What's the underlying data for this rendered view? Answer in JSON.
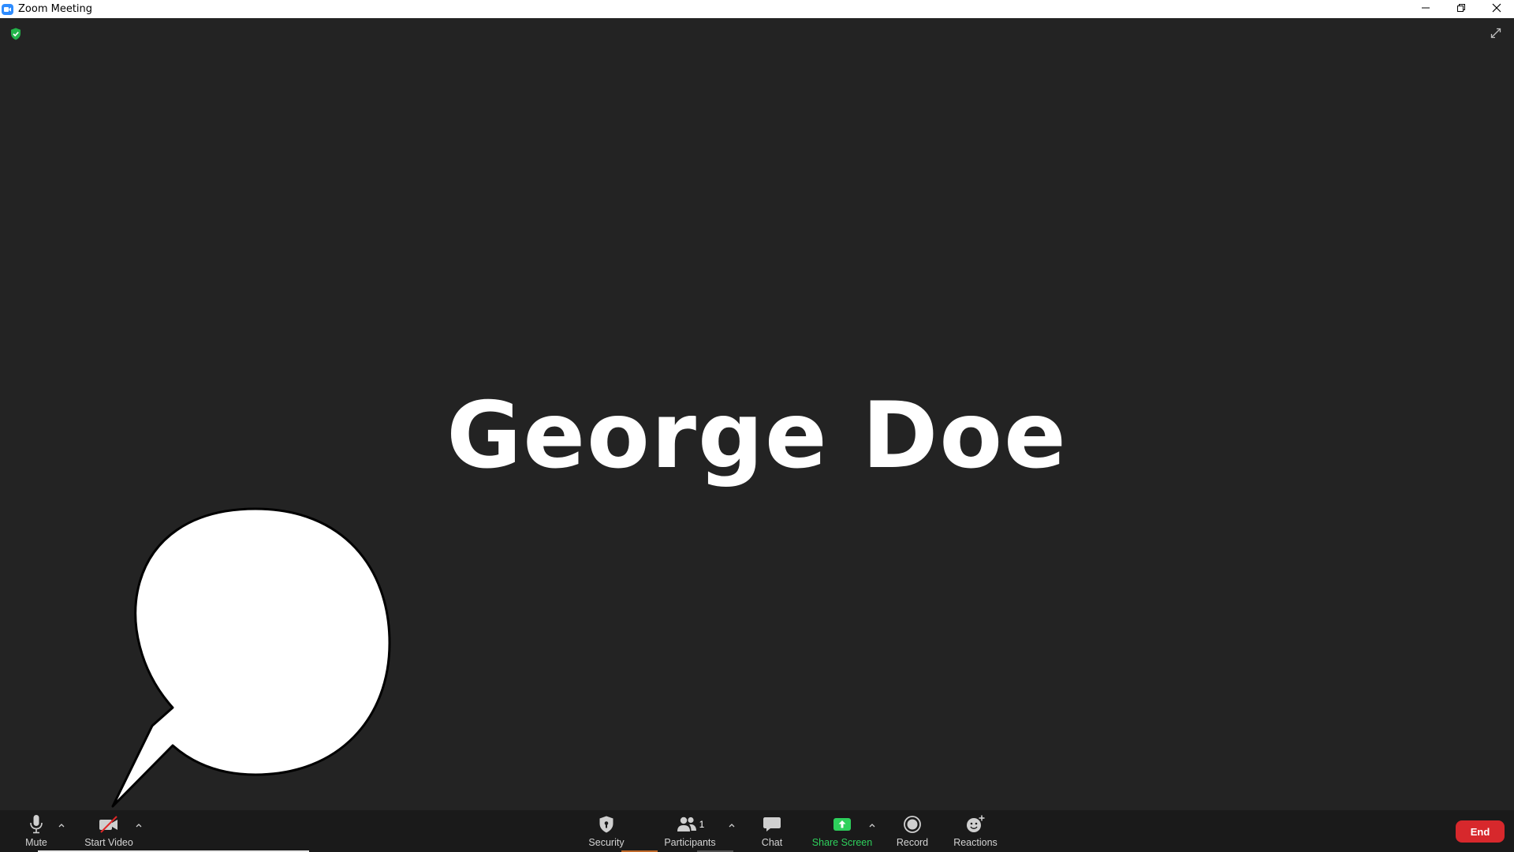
{
  "window": {
    "title": "Zoom Meeting"
  },
  "meeting": {
    "participant_name": "George Doe"
  },
  "toolbar": {
    "mute_label": "Mute",
    "start_video_label": "Start Video",
    "security_label": "Security",
    "participants_label": "Participants",
    "participants_count": "1",
    "chat_label": "Chat",
    "share_screen_label": "Share Screen",
    "record_label": "Record",
    "reactions_label": "Reactions",
    "end_label": "End"
  },
  "colors": {
    "background": "#232323",
    "toolbar": "#1a1a1a",
    "share_green": "#2ed05c",
    "end_red": "#d7282c",
    "zoom_blue": "#2d8cff"
  }
}
